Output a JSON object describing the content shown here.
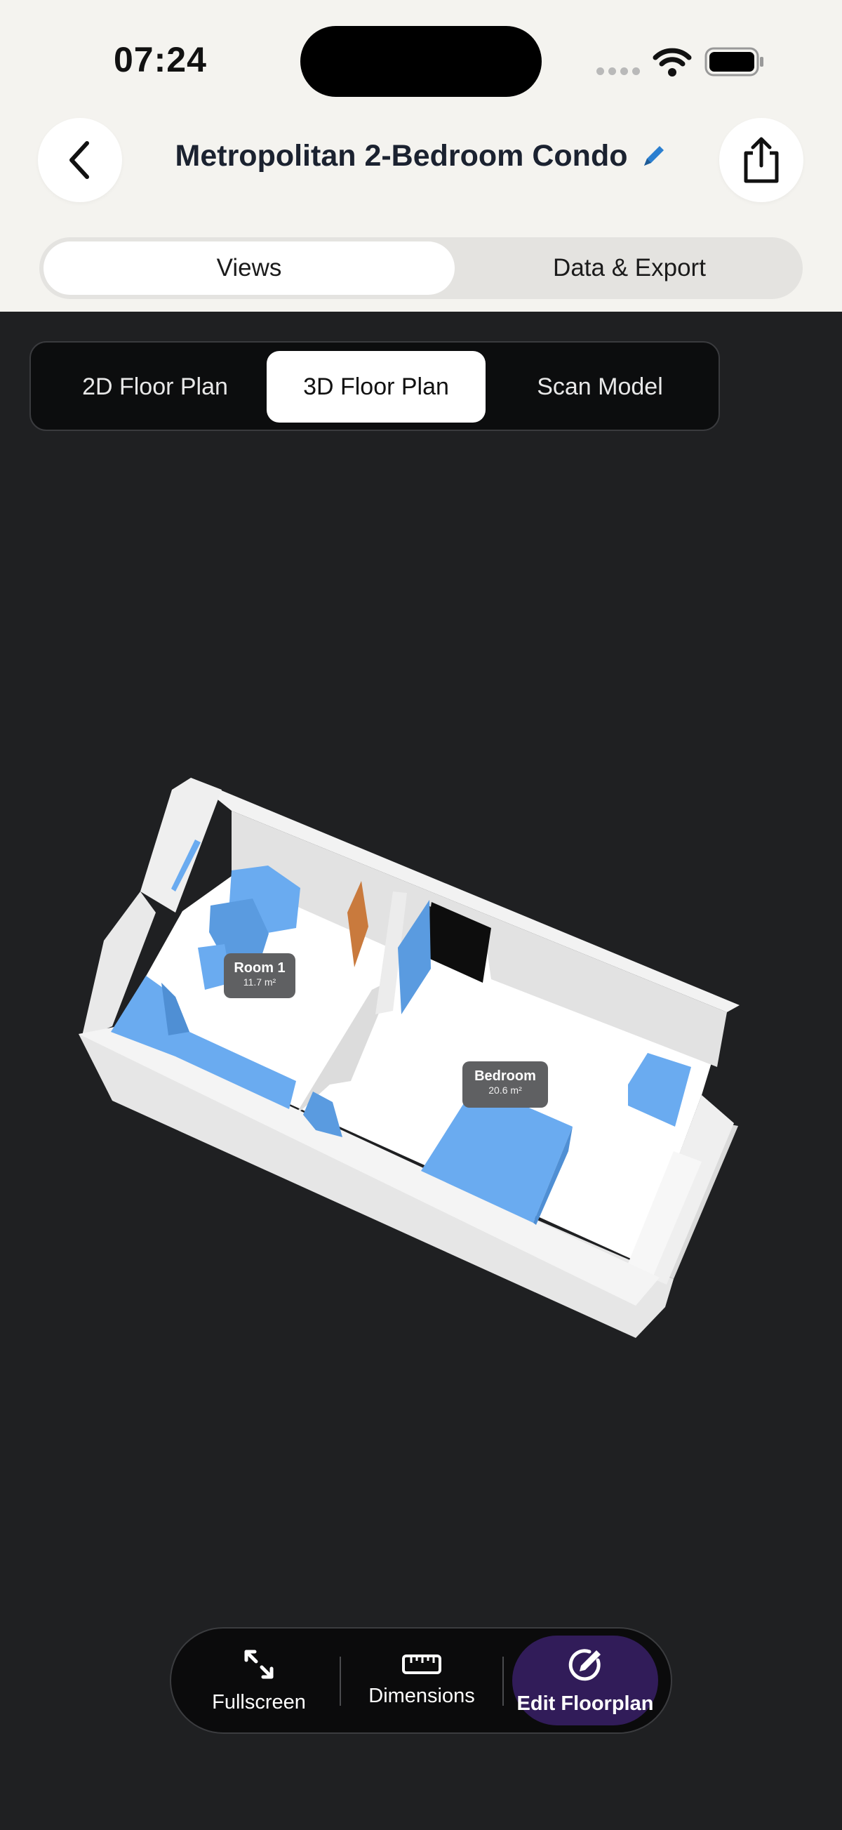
{
  "status_bar": {
    "time": "07:24"
  },
  "header": {
    "title": "Metropolitan 2-Bedroom Condo",
    "back_icon": "chevron-left-icon",
    "edit_icon": "pencil-icon",
    "share_icon": "share-icon"
  },
  "segmented": {
    "tabs": [
      "Views",
      "Data & Export"
    ],
    "selected": "Views"
  },
  "view_tabs": {
    "items": [
      "2D Floor Plan",
      "3D Floor Plan",
      "Scan Model"
    ],
    "selected": "3D Floor Plan"
  },
  "model": {
    "rooms": [
      {
        "name": "Room 1",
        "area": "11.7 m²"
      },
      {
        "name": "Bedroom",
        "area": "20.6 m²"
      }
    ],
    "colors": {
      "walls": "#eeeeee",
      "furniture": "#6aabf0",
      "door": "#c97a3d",
      "floor": "#ffffff"
    }
  },
  "toolbar": {
    "fullscreen": "Fullscreen",
    "dimensions": "Dimensions",
    "edit": "Edit Floorplan",
    "accent": "#311c59"
  }
}
